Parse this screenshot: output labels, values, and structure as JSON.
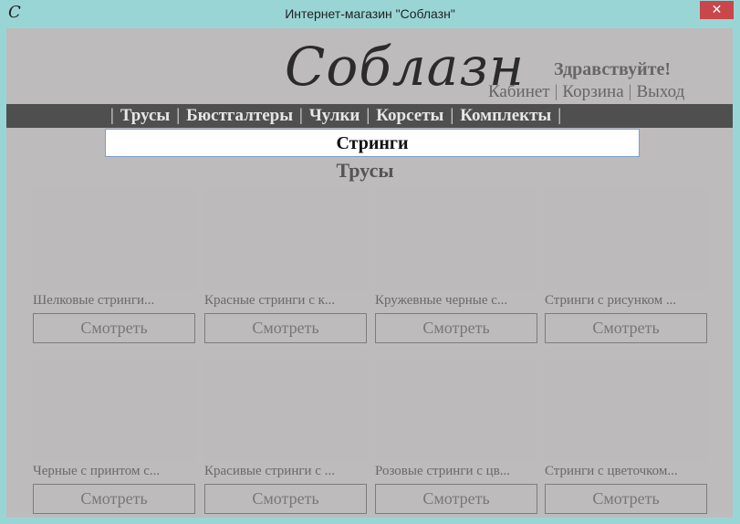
{
  "window": {
    "title": "Интернет-магазин \"Соблазн\"",
    "icon_glyph": "C",
    "close_glyph": "✕"
  },
  "header": {
    "logo_text": "Соблазн",
    "greeting": "Здравствуйте!",
    "links": [
      "Кабинет",
      "Корзина",
      "Выход"
    ],
    "separator": "|"
  },
  "nav": {
    "separator": "|",
    "items": [
      "Трусы",
      "Бюстгалтеры",
      "Чулки",
      "Корсеты",
      "Комплекты"
    ]
  },
  "subcategory": {
    "label": "Стринги"
  },
  "section_title": "Трусы",
  "products": [
    {
      "name": "Шелковые стринги...",
      "button": "Смотреть"
    },
    {
      "name": "Красные стринги с к...",
      "button": "Смотреть"
    },
    {
      "name": "Кружевные черные с...",
      "button": "Смотреть"
    },
    {
      "name": "Стринги с рисунком ...",
      "button": "Смотреть"
    },
    {
      "name": "Черные с принтом  с...",
      "button": "Смотреть"
    },
    {
      "name": "Красивые стринги с ...",
      "button": "Смотреть"
    },
    {
      "name": "Розовые стринги с цв...",
      "button": "Смотреть"
    },
    {
      "name": "Стринги с цветочком...",
      "button": "Смотреть"
    }
  ],
  "colors": {
    "frame": "#9ad5d6",
    "client_bg": "#bdbbbc",
    "navbar": "#4f4f4f",
    "close": "#c9464a"
  }
}
